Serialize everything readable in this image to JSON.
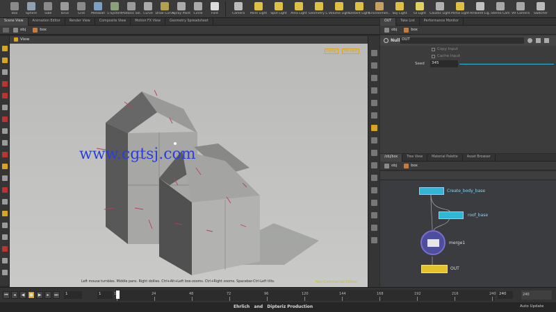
{
  "shelf": {
    "tools": [
      {
        "label": "Box",
        "icon": "box-icon"
      },
      {
        "label": "Sphere",
        "icon": "sphere-icon"
      },
      {
        "label": "Tube",
        "icon": "tube-icon"
      },
      {
        "label": "Torus",
        "icon": "torus-icon"
      },
      {
        "label": "Grid",
        "icon": "grid-icon"
      },
      {
        "label": "Metaball",
        "icon": "metaball-icon"
      },
      {
        "label": "L-System",
        "icon": "lsystem-icon"
      },
      {
        "label": "Platonic Sol.",
        "icon": "platonic-icon"
      },
      {
        "label": "Curve",
        "icon": "curve-icon"
      },
      {
        "label": "Draw Curve",
        "icon": "draw-curve-icon"
      },
      {
        "label": "Spray Paint",
        "icon": "spray-paint-icon"
      },
      {
        "label": "Circle",
        "icon": "circle-icon"
      },
      {
        "label": "Font",
        "icon": "font-icon"
      }
    ],
    "lights": [
      {
        "label": "Camera",
        "icon": "camera-icon"
      },
      {
        "label": "Point Light",
        "icon": "point-light-icon"
      },
      {
        "label": "Spot Light",
        "icon": "spot-light-icon"
      },
      {
        "label": "Area Light",
        "icon": "area-light-icon"
      },
      {
        "label": "Geometry L...",
        "icon": "geometry-light-icon"
      },
      {
        "label": "Volume Light",
        "icon": "volume-light-icon"
      },
      {
        "label": "Distant Light",
        "icon": "distant-light-icon"
      },
      {
        "label": "Environmen...",
        "icon": "environment-light-icon"
      },
      {
        "label": "Sky Light",
        "icon": "sky-light-icon"
      },
      {
        "label": "GI Light",
        "icon": "gi-light-icon"
      },
      {
        "label": "Caustic Light",
        "icon": "caustic-light-icon"
      },
      {
        "label": "Portal Light",
        "icon": "portal-light-icon"
      },
      {
        "label": "Ambient Lig...",
        "icon": "ambient-light-icon"
      },
      {
        "label": "Stereo Cam",
        "icon": "stereo-camera-icon"
      },
      {
        "label": "VR Camera",
        "icon": "vr-camera-icon"
      },
      {
        "label": "Switcher",
        "icon": "switcher-icon"
      }
    ]
  },
  "left_tabs": [
    "Scene View",
    "Animation Editor",
    "Render View",
    "Composite View",
    "Motion FX View",
    "Geometry Spreadsheet"
  ],
  "left_path": {
    "obj": "obj",
    "node": "box"
  },
  "viewport": {
    "title": "View",
    "hint": "Left mouse tumbles. Middle pans. Right dollies. Ctrl+Alt+Left box-zooms. Ctrl+Right zooms. Spacebar-Ctrl-Left tilts.",
    "edition": "Non-Commercial Edition",
    "watermark": "www.cgtsj.com",
    "persp": "Persp",
    "cam": "No cam"
  },
  "right_tabs_top": [
    "OUT",
    "Take List",
    "Performance Monitor"
  ],
  "right_path_top": {
    "obj": "obj",
    "node": "box"
  },
  "params": {
    "node_type": "Null",
    "node_name": "OUT",
    "copy_input": "Copy Input",
    "cache_input": "Cache Input",
    "seed_label": "Seed",
    "seed_value": "345"
  },
  "right_tabs_bottom": [
    "/obj/box",
    "Tree View",
    "Material Palette",
    "Asset Browser"
  ],
  "right_path_bottom": {
    "obj": "obj",
    "node": "box"
  },
  "nodes": [
    {
      "name": "Create_body_base"
    },
    {
      "name": "roof_base"
    },
    {
      "name": "merge1"
    },
    {
      "name": "OUT"
    }
  ],
  "timeline": {
    "frame": "1",
    "start": "1",
    "end": "240",
    "end2": "240",
    "ticks": [
      "1",
      "24",
      "48",
      "72",
      "96",
      "120",
      "144",
      "168",
      "192",
      "216",
      "240"
    ],
    "auto_update": "Auto Update"
  },
  "status": {
    "credit": "Ehrlich   and   Dipteriz Production"
  },
  "colors": {
    "accent": "#d9a420",
    "node_cyan": "#2fb7d8",
    "node_yellow": "#e3c22c",
    "watermark": "#2a3fd6"
  }
}
